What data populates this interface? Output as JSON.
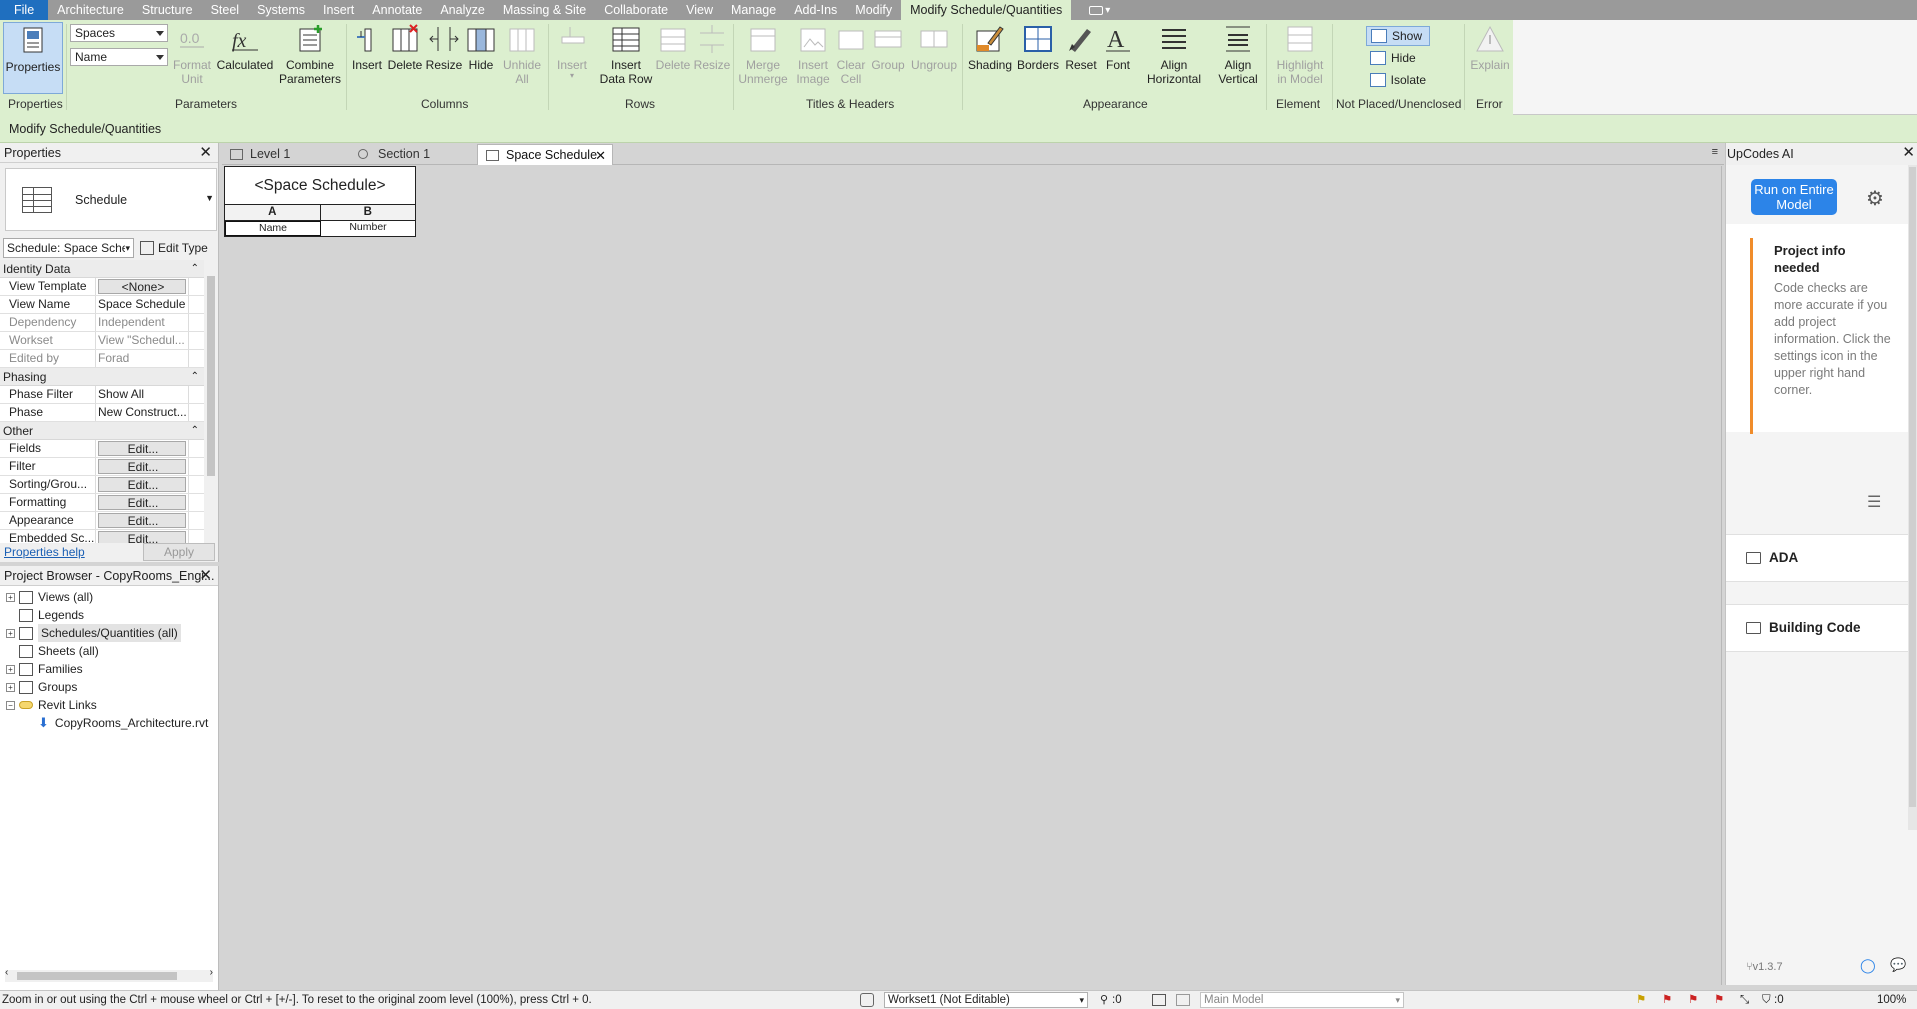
{
  "menu": {
    "file": "File",
    "items": [
      "Architecture",
      "Structure",
      "Steel",
      "Systems",
      "Insert",
      "Annotate",
      "Analyze",
      "Massing & Site",
      "Collaborate",
      "View",
      "Manage",
      "Add-Ins",
      "Modify"
    ],
    "active": "Modify Schedule/Quantities"
  },
  "ribbon": {
    "properties": "Properties",
    "combo_category": "Spaces",
    "combo_field": "Name",
    "format_unit": "Format\nUnit",
    "calculated": "Calculated",
    "combine": "Combine\nParameters",
    "col_insert": "Insert",
    "col_delete": "Delete",
    "col_resize": "Resize",
    "col_hide": "Hide",
    "col_unhide": "Unhide\nAll",
    "row_insert": "Insert",
    "row_insert_data": "Insert\nData Row",
    "row_delete": "Delete",
    "row_resize": "Resize",
    "merge": "Merge\nUnmerge",
    "insert_image": "Insert\nImage",
    "clear_cell": "Clear\nCell",
    "group": "Group",
    "ungroup": "Ungroup",
    "shading": "Shading",
    "borders": "Borders",
    "reset": "Reset",
    "font": "Font",
    "align_h": "Align\nHorizontal",
    "align_v": "Align\nVertical",
    "highlight": "Highlight\nin Model",
    "show": "Show",
    "hide": "Hide",
    "isolate": "Isolate",
    "explain": "Explain",
    "panels": {
      "properties": "Properties",
      "parameters": "Parameters",
      "columns": "Columns",
      "rows": "Rows",
      "titles": "Titles & Headers",
      "appearance": "Appearance",
      "element": "Element",
      "notplaced": "Not Placed/Unenclosed",
      "error": "Error"
    }
  },
  "context_bar": "Modify Schedule/Quantities",
  "properties_panel": {
    "title": "Properties",
    "type_name": "Schedule",
    "instance_select": "Schedule: Space Sche",
    "edit_type": "Edit Type",
    "groups": [
      {
        "name": "Identity Data",
        "rows": [
          {
            "k": "View Template",
            "v": "<None>",
            "btn": true
          },
          {
            "k": "View Name",
            "v": "Space Schedule"
          },
          {
            "k": "Dependency",
            "v": "Independent",
            "dim": true
          },
          {
            "k": "Workset",
            "v": "View \"Schedul...",
            "dim": true
          },
          {
            "k": "Edited by",
            "v": "Forad",
            "dim": true
          }
        ]
      },
      {
        "name": "Phasing",
        "rows": [
          {
            "k": "Phase Filter",
            "v": "Show All"
          },
          {
            "k": "Phase",
            "v": "New Construct..."
          }
        ]
      },
      {
        "name": "Other",
        "rows": [
          {
            "k": "Fields",
            "v": "Edit...",
            "btn": true
          },
          {
            "k": "Filter",
            "v": "Edit...",
            "btn": true
          },
          {
            "k": "Sorting/Grou...",
            "v": "Edit...",
            "btn": true
          },
          {
            "k": "Formatting",
            "v": "Edit...",
            "btn": true
          },
          {
            "k": "Appearance",
            "v": "Edit...",
            "btn": true
          },
          {
            "k": "Embedded Sc...",
            "v": "Edit...",
            "btn": true
          }
        ]
      }
    ],
    "help": "Properties help",
    "apply": "Apply"
  },
  "browser": {
    "title": "Project Browser - CopyRooms_Engi...",
    "items": [
      {
        "label": "Views (all)",
        "pm": "+",
        "icon": "views-icon"
      },
      {
        "label": "Legends",
        "pm": "",
        "icon": "legend-icon"
      },
      {
        "label": "Schedules/Quantities (all)",
        "pm": "+",
        "icon": "schedule-icon",
        "hl": true
      },
      {
        "label": "Sheets (all)",
        "pm": "",
        "icon": "sheet-icon"
      },
      {
        "label": "Families",
        "pm": "+",
        "icon": "family-icon"
      },
      {
        "label": "Groups",
        "pm": "+",
        "icon": "group-icon"
      },
      {
        "label": "Revit Links",
        "pm": "−",
        "icon": "link-icon"
      },
      {
        "label": "CopyRooms_Architecture.rvt",
        "pm": "",
        "icon": "revit-link-file-icon",
        "child": true
      }
    ]
  },
  "tabs": [
    {
      "label": "Level 1",
      "icon": "floor-plan-icon"
    },
    {
      "label": "Section 1",
      "icon": "section-icon"
    },
    {
      "label": "Space Schedule",
      "icon": "schedule-icon",
      "active": true
    }
  ],
  "schedule": {
    "title": "<Space Schedule>",
    "col_a": "A",
    "col_b": "B",
    "field_a": "Name",
    "field_b": "Number"
  },
  "upcodes": {
    "title": "UpCodes AI",
    "run": "Run on Entire Model",
    "info_title": "Project info needed",
    "info_body": "Code checks are more accurate if you add project information. Click the settings icon in the upper right hand corner.",
    "sections": [
      "ADA",
      "Building Code"
    ],
    "version": "v1.3.7"
  },
  "status": {
    "hint": "Zoom in or out using the Ctrl + mouse wheel or Ctrl + [+/-]. To reset to the original zoom level (100%), press Ctrl + 0.",
    "workset": "Workset1 (Not Editable)",
    "sync": ":0",
    "model": "Main Model",
    "filter": ":0",
    "zoom": "100%"
  },
  "colors": {
    "file_tab": "#1f6fbf",
    "context_green": "#dcefcf",
    "run_button": "#2c84e8",
    "info_accent": "#f08c2a"
  }
}
